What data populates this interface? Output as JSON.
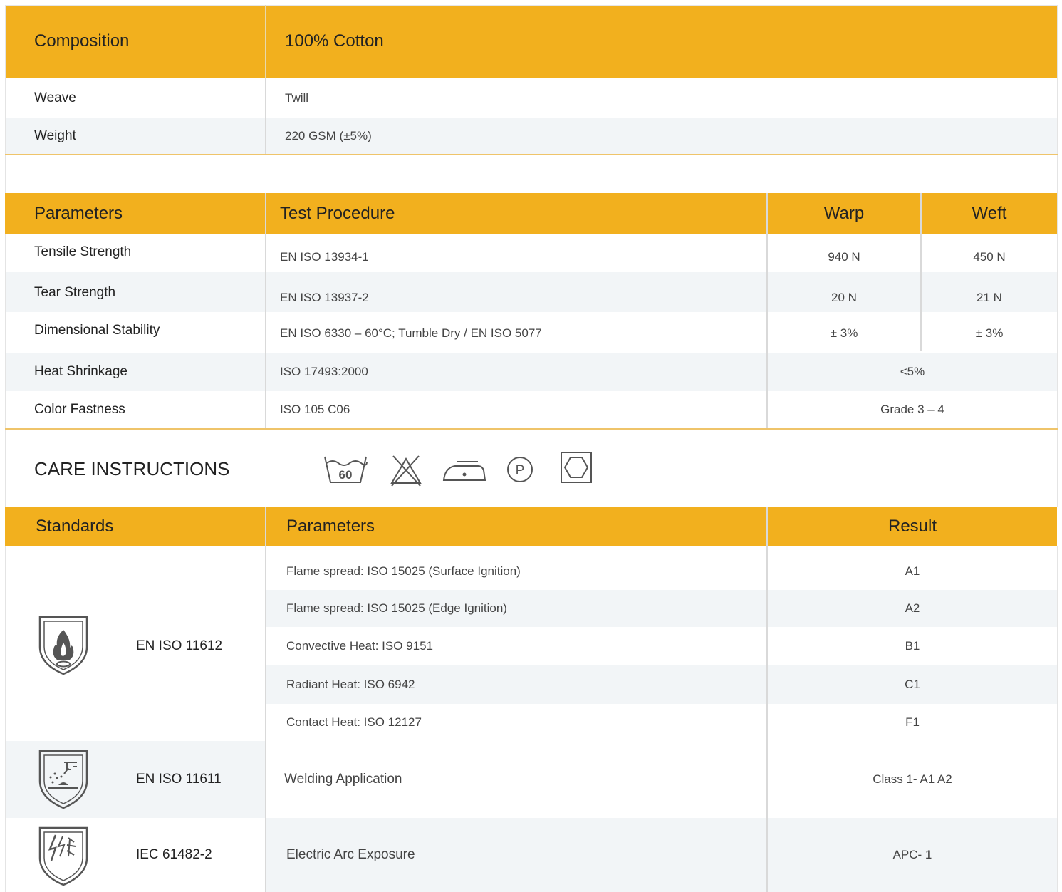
{
  "fabric": {
    "composition_label": "Composition",
    "composition_value": "100% Cotton",
    "rows": [
      {
        "label": "Weave",
        "value": "Twill"
      },
      {
        "label": "Weight",
        "value": "220 GSM (±5%)"
      }
    ]
  },
  "performance": {
    "headers": {
      "parameters": "Parameters",
      "procedure": "Test Procedure",
      "warp": "Warp",
      "weft": "Weft"
    },
    "rows": [
      {
        "parameter": "Tensile Strength",
        "procedure": "EN ISO 13934-1",
        "warp": "940 N",
        "weft": "450 N"
      },
      {
        "parameter": "Tear Strength",
        "procedure": "EN ISO 13937-2",
        "warp": "20 N",
        "weft": "21 N"
      },
      {
        "parameter": "Dimensional Stability",
        "procedure": "EN ISO 6330 – 60°C; Tumble Dry / EN ISO 5077",
        "warp": "± 3%",
        "weft": "± 3%"
      },
      {
        "parameter": "Heat Shrinkage",
        "procedure": "ISO 17493:2000",
        "result": "<5%"
      },
      {
        "parameter": "Color Fastness",
        "procedure": "ISO 105 C06",
        "result": "Grade 3 – 4"
      }
    ]
  },
  "care": {
    "title": "CARE INSTRUCTIONS",
    "wash_temp": "60",
    "professional_clean_letter": "P",
    "icons": [
      "wash-60-icon",
      "no-bleach-icon",
      "iron-low-icon",
      "professional-clean-p-icon",
      "tumble-dry-icon"
    ]
  },
  "standards": {
    "headers": {
      "standards": "Standards",
      "parameters": "Parameters",
      "result": "Result"
    },
    "iso11612": {
      "name": "EN ISO 11612",
      "icon": "flame-shield-icon",
      "tests": [
        {
          "parameter": "Flame spread: ISO 15025 (Surface Ignition)",
          "result": "A1"
        },
        {
          "parameter": "Flame spread: ISO 15025 (Edge Ignition)",
          "result": "A2"
        },
        {
          "parameter": "Convective Heat: ISO 9151",
          "result": "B1"
        },
        {
          "parameter": "Radiant Heat: ISO 6942",
          "result": "C1"
        },
        {
          "parameter": "Contact Heat: ISO 12127",
          "result": "F1"
        }
      ]
    },
    "iso11611": {
      "name": "EN ISO 11611",
      "icon": "welding-shield-icon",
      "parameter": "Welding Application",
      "result": "Class 1- A1 A2"
    },
    "iec61482": {
      "name": "IEC 61482-2",
      "icon": "electric-arc-shield-icon",
      "parameter": "Electric Arc Exposure",
      "result": "APC- 1"
    }
  }
}
